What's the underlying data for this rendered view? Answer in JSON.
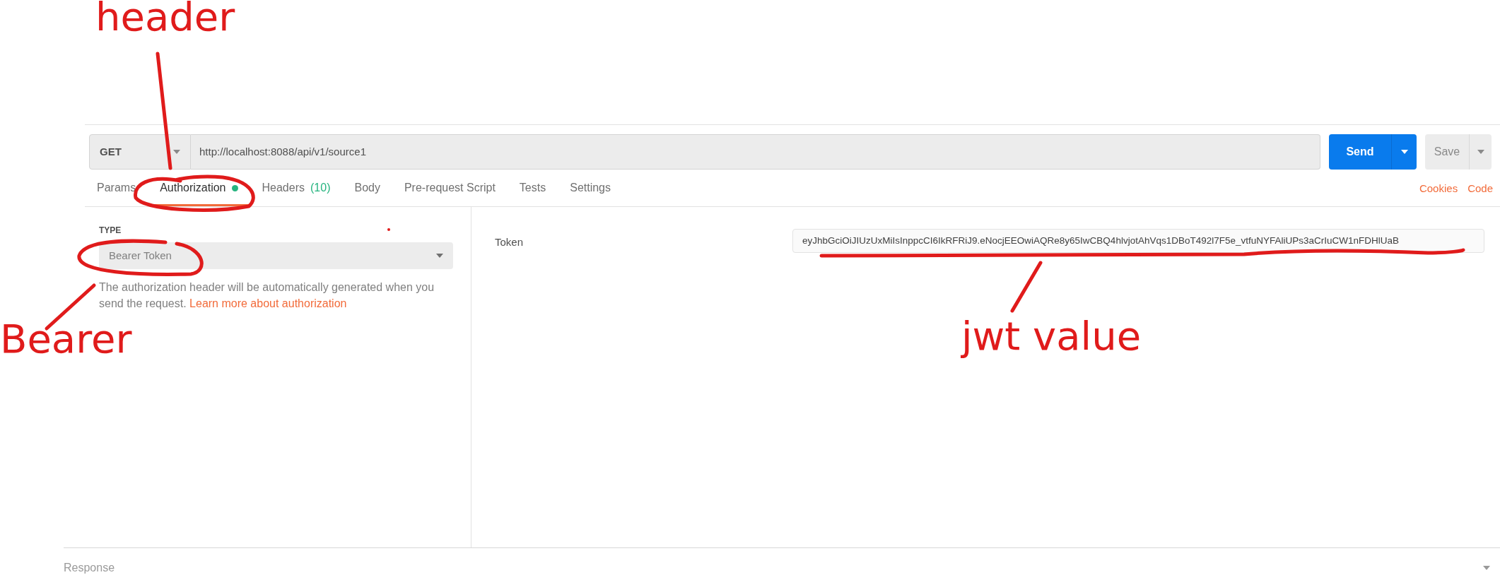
{
  "request": {
    "method": "GET",
    "url": "http://localhost:8088/api/v1/source1",
    "send_label": "Send",
    "save_label": "Save"
  },
  "tabs": [
    {
      "label": "Params",
      "selected": false,
      "dot": false
    },
    {
      "label": "Authorization",
      "selected": true,
      "dot": true
    },
    {
      "label": "Headers",
      "count": "(10)",
      "selected": false,
      "dot": false
    },
    {
      "label": "Body",
      "selected": false,
      "dot": false
    },
    {
      "label": "Pre-request Script",
      "selected": false,
      "dot": false
    },
    {
      "label": "Tests",
      "selected": false,
      "dot": false
    },
    {
      "label": "Settings",
      "selected": false,
      "dot": false
    }
  ],
  "links": [
    "Cookies",
    "Code"
  ],
  "auth": {
    "type_label": "TYPE",
    "type_value": "Bearer Token",
    "description": "The authorization header will be automatically generated when you send the request.",
    "learn_more": "Learn more about authorization",
    "token_label": "Token",
    "token_value": "eyJhbGciOiJIUzUxMiIsInppcCI6IkRFRiJ9.eNocjEEOwiAQRe8y65IwCBQ4hlvjotAhVqs1DBoT492l7F5e_vtfuNYFAliUPs3aCrIuCW1nFDHlUaB"
  },
  "response_label": "Response",
  "annotations": [
    {
      "text": "header"
    },
    {
      "text": "Bearer"
    },
    {
      "text": "jwt value"
    }
  ]
}
